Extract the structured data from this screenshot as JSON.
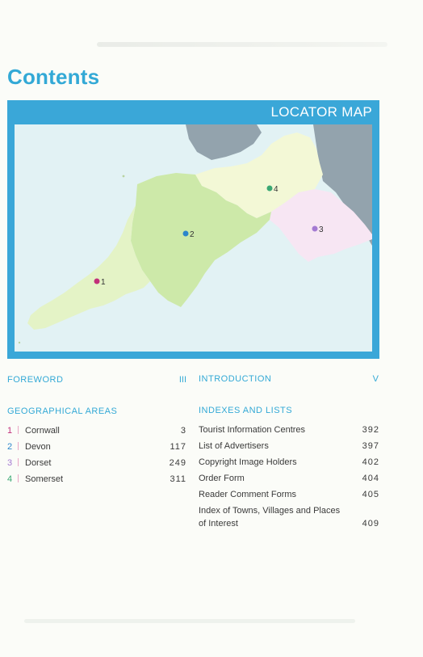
{
  "page": {
    "title": "Contents"
  },
  "map": {
    "title": "LOCATOR MAP",
    "colors": {
      "sea": "#e2f2f4",
      "cornwall": "#e4f3c6",
      "devon": "#cde9a9",
      "somerset": "#f3f8d6",
      "dorset": "#f7e6f3",
      "neighbour": "#93a3ad",
      "frame": "#3aa7d8"
    },
    "markers": [
      {
        "label": "1",
        "name": "Cornwall",
        "color": "#c2307a"
      },
      {
        "label": "2",
        "name": "Devon",
        "color": "#2c86cb"
      },
      {
        "label": "3",
        "name": "Dorset",
        "color": "#a47ad2"
      },
      {
        "label": "4",
        "name": "Somerset",
        "color": "#3aa873"
      }
    ]
  },
  "toc": {
    "foreword": {
      "label": "FOREWORD",
      "page": "III"
    },
    "introduction": {
      "label": "INTRODUCTION",
      "page": "V"
    },
    "geo_heading": "GEOGRAPHICAL AREAS",
    "areas": [
      {
        "num": "1",
        "label": "Cornwall",
        "page": "3",
        "color": "#c2307a"
      },
      {
        "num": "2",
        "label": "Devon",
        "page": "117",
        "color": "#2c86cb"
      },
      {
        "num": "3",
        "label": "Dorset",
        "page": "249",
        "color": "#a47ad2"
      },
      {
        "num": "4",
        "label": "Somerset",
        "page": "311",
        "color": "#3aa873"
      }
    ],
    "indexes_heading": "INDEXES AND LISTS",
    "indexes": [
      {
        "label": "Tourist Information Centres",
        "page": "392"
      },
      {
        "label": "List of Advertisers",
        "page": "397"
      },
      {
        "label": "Copyright Image Holders",
        "page": "402"
      },
      {
        "label": "Order Form",
        "page": "404"
      },
      {
        "label": "Reader Comment Forms",
        "page": "405"
      },
      {
        "label": "Index of Towns, Villages and Places of Interest",
        "page": "409"
      }
    ]
  }
}
